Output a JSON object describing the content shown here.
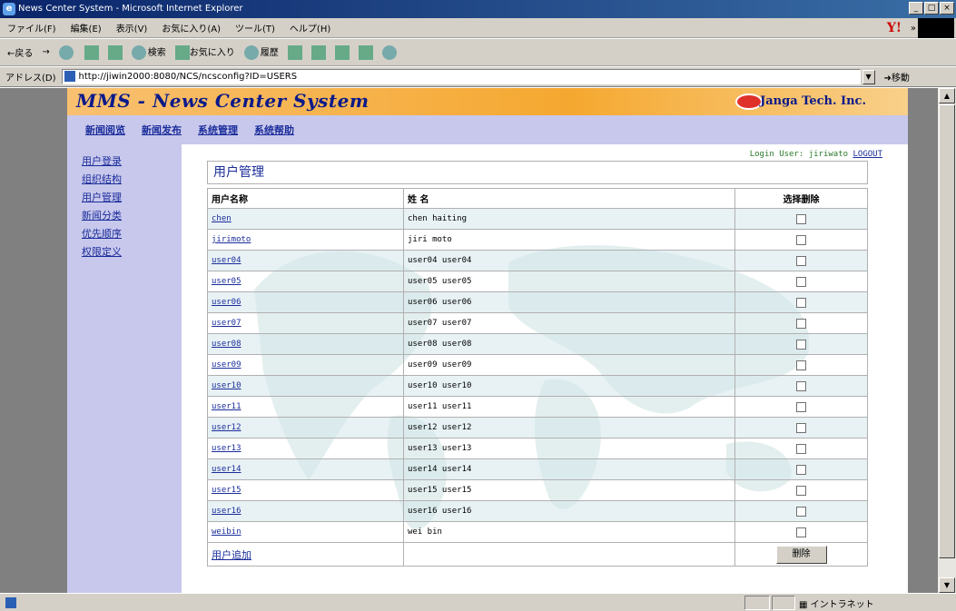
{
  "window": {
    "title": "News Center System - Microsoft Internet Explorer",
    "buttons": [
      "_",
      "□",
      "×"
    ]
  },
  "menu": [
    "ファイル(F)",
    "編集(E)",
    "表示(V)",
    "お気に入り(A)",
    "ツール(T)",
    "ヘルプ(H)"
  ],
  "toolbar": {
    "back": "←戻る",
    "search": "検索",
    "favorites": "お気に入り",
    "history": "履歴"
  },
  "address": {
    "label": "アドレス(D)",
    "url": "http://jiwin2000:8080/NCS/ncsconfig?ID=USERS",
    "go": "移動"
  },
  "banner": {
    "logo": "MMS - News Center System",
    "company": "Janga Tech. Inc."
  },
  "nav": [
    "新闻阅览",
    "新闻发布",
    "系统管理",
    "系统帮助"
  ],
  "sidebar": [
    "用户登录",
    "组织结构",
    "用户管理",
    "新闻分类",
    "优先顺序",
    "权限定义"
  ],
  "login": {
    "text": "Login User: jiriwato",
    "logout": "LOGOUT"
  },
  "page_title": "用户管理",
  "table": {
    "headers": [
      "用户名称",
      "姓 名",
      "选择删除"
    ],
    "rows": [
      {
        "user": "chen",
        "name": "chen haiting"
      },
      {
        "user": "jirimoto",
        "name": "jiri moto"
      },
      {
        "user": "user04",
        "name": "user04 user04"
      },
      {
        "user": "user05",
        "name": "user05 user05"
      },
      {
        "user": "user06",
        "name": "user06 user06"
      },
      {
        "user": "user07",
        "name": "user07 user07"
      },
      {
        "user": "user08",
        "name": "user08 user08"
      },
      {
        "user": "user09",
        "name": "user09 user09"
      },
      {
        "user": "user10",
        "name": "user10 user10"
      },
      {
        "user": "user11",
        "name": "user11 user11"
      },
      {
        "user": "user12",
        "name": "user12 user12"
      },
      {
        "user": "user13",
        "name": "user13 user13"
      },
      {
        "user": "user14",
        "name": "user14 user14"
      },
      {
        "user": "user15",
        "name": "user15 user15"
      },
      {
        "user": "user16",
        "name": "user16 user16"
      },
      {
        "user": "weibin",
        "name": "wei bin"
      }
    ],
    "add_link": "用户追加",
    "delete_button": "删除"
  },
  "status": {
    "zone": "イントラネット"
  },
  "colors": {
    "banner": "#f5a830",
    "nav_bg": "#c8c8ec",
    "link": "#1a2c9a",
    "login": "#2a7a2a"
  }
}
